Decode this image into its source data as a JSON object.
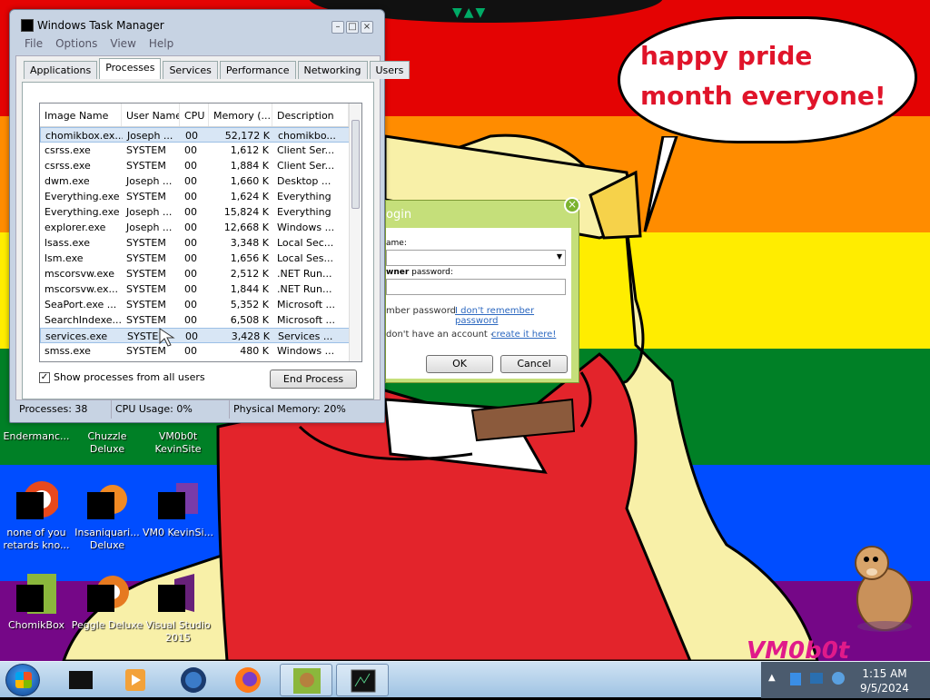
{
  "wallpaper": {
    "speech_text": "happy pride month everyone!",
    "watermark": "VM0b0t",
    "colors": [
      "#e40303",
      "#ff8c00",
      "#ffed00",
      "#008026",
      "#004dff",
      "#750787"
    ]
  },
  "task_manager": {
    "title": "Windows Task Manager",
    "menu": [
      "File",
      "Options",
      "View",
      "Help"
    ],
    "tabs": [
      "Applications",
      "Processes",
      "Services",
      "Performance",
      "Networking",
      "Users"
    ],
    "active_tab": "Processes",
    "columns": [
      "Image Name",
      "User Name",
      "CPU",
      "Memory (...",
      "Description"
    ],
    "rows": [
      [
        "chomikbox.ex...",
        "Joseph ...",
        "00",
        "52,172 K",
        "chomikbo..."
      ],
      [
        "csrss.exe",
        "SYSTEM",
        "00",
        "1,612 K",
        "Client Ser..."
      ],
      [
        "csrss.exe",
        "SYSTEM",
        "00",
        "1,884 K",
        "Client Ser..."
      ],
      [
        "dwm.exe",
        "Joseph ...",
        "00",
        "1,660 K",
        "Desktop ..."
      ],
      [
        "Everything.exe",
        "SYSTEM",
        "00",
        "1,624 K",
        "Everything"
      ],
      [
        "Everything.exe",
        "Joseph ...",
        "00",
        "15,824 K",
        "Everything"
      ],
      [
        "explorer.exe",
        "Joseph ...",
        "00",
        "12,668 K",
        "Windows ..."
      ],
      [
        "lsass.exe",
        "SYSTEM",
        "00",
        "3,348 K",
        "Local Sec..."
      ],
      [
        "lsm.exe",
        "SYSTEM",
        "00",
        "1,656 K",
        "Local Ses..."
      ],
      [
        "mscorsvw.exe",
        "SYSTEM",
        "00",
        "2,512 K",
        ".NET Run..."
      ],
      [
        "mscorsvw.ex...",
        "SYSTEM",
        "00",
        "1,844 K",
        ".NET Run..."
      ],
      [
        "SeaPort.exe ...",
        "SYSTEM",
        "00",
        "5,352 K",
        "Microsoft ..."
      ],
      [
        "SearchIndexe...",
        "SYSTEM",
        "00",
        "6,508 K",
        "Microsoft ..."
      ],
      [
        "services.exe",
        "SYSTEM",
        "00",
        "3,428 K",
        "Services ..."
      ],
      [
        "smss.exe",
        "SYSTEM",
        "00",
        "480 K",
        "Windows ..."
      ]
    ],
    "selected_rows": [
      0,
      13
    ],
    "show_all_label": "Show processes from all users",
    "show_all_checked": true,
    "end_process_label": "End Process",
    "status": {
      "processes": "Processes: 38",
      "cpu": "CPU Usage: 0%",
      "memory": "Physical Memory: 20%"
    }
  },
  "login_dialog": {
    "title": "ogin",
    "username_label": "ame:",
    "password_label_bold": "wner",
    "password_label_rest": " password:",
    "remember_label": "mber password",
    "forgot_link": "I don't remember password",
    "no_account_text": "don't have an account -",
    "create_link": "create it here!",
    "ok_label": "OK",
    "cancel_label": "Cancel",
    "close_glyph": "×"
  },
  "desktop_icons": [
    {
      "label": "Endermanc...",
      "icon": "app-icon"
    },
    {
      "label": "Chuzzle Deluxe",
      "icon": "game-icon"
    },
    {
      "label": "VM0b0t KevinSite",
      "icon": "shortcut-icon"
    },
    {
      "label": "none of you retards kno...",
      "icon": "browser-icon"
    },
    {
      "label": "Insaniquari... Deluxe",
      "icon": "game-icon"
    },
    {
      "label": "VM0 KevinSi...",
      "icon": "shortcut-icon"
    },
    {
      "label": "ChomikBox",
      "icon": "chomikbox-icon"
    },
    {
      "label": "Peggle Deluxe",
      "icon": "game-icon"
    },
    {
      "label": "Visual Studio 2015",
      "icon": "visual-studio-icon"
    }
  ],
  "taskbar": {
    "items": [
      "explorer-icon",
      "media-player-icon",
      "globe-icon",
      "firefox-icon",
      "chomikbox-icon",
      "task-manager-icon"
    ],
    "time": "1:15 AM",
    "date": "9/5/2024"
  }
}
